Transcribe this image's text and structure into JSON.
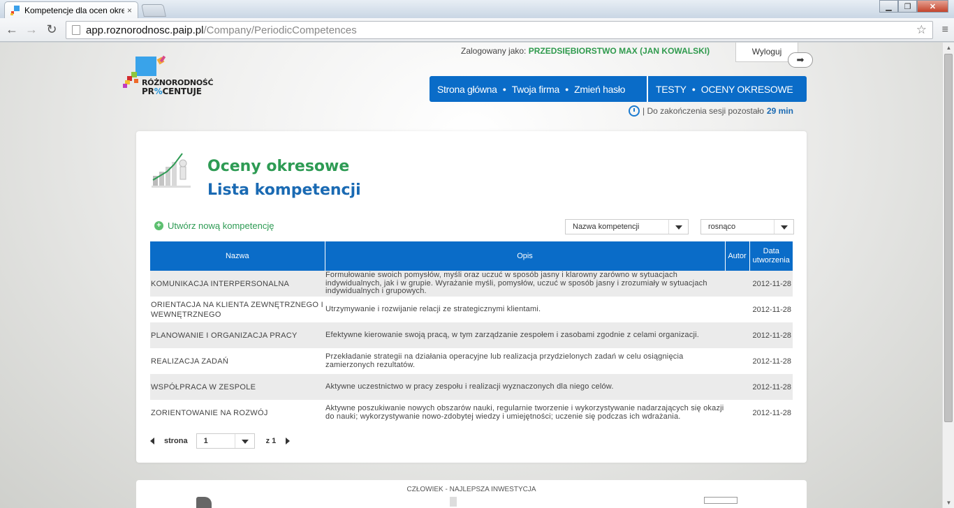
{
  "browser": {
    "tab_title": "Kompetencje dla ocen okresowych",
    "tab_close": "×",
    "url_host": "app.roznorodnosc.paip.pl",
    "url_path": "/Company/PeriodicCompetences",
    "back": "←",
    "forward": "→",
    "reload": "↻",
    "star": "☆",
    "menu": "≡",
    "minimize": "▁",
    "maximize": "❐",
    "close": "✕"
  },
  "header": {
    "logo_line1": "RÓŻNORODNOŚĆ",
    "logo_line2_a": "PR",
    "logo_line2_pct": "%",
    "logo_line2_b": "CENTUJE",
    "login_label": "Zalogowany jako:",
    "login_user": "PRZEDSIĘBIORSTWO MAX (JAN KOWALSKI)",
    "logout_label": "Wyloguj",
    "logout_icon": "➡",
    "nav_group1": [
      "Strona główna",
      "Twoja firma",
      "Zmień hasło"
    ],
    "nav_group2": [
      "TESTY",
      "OCENY OKRESOWE"
    ],
    "nav_dot": "●",
    "session_text": "| Do zakończenia sesji pozostało",
    "session_minutes": "29 min"
  },
  "main": {
    "heading": "Oceny okresowe",
    "subheading": "Lista kompetencji",
    "create_label": "Utwórz nową kompetencję",
    "create_icon": "+",
    "sort_field": "Nazwa kompetencji",
    "sort_order": "rosnąco",
    "columns": [
      "Nazwa",
      "Opis",
      "Autor",
      "Data utworzenia"
    ],
    "rows": [
      {
        "name": "KOMUNIKACJA INTERPERSONALNA",
        "desc": "Formułowanie swoich pomysłów, myśli oraz uczuć w sposób jasny i klarowny zarówno w sytuacjach indywidualnych, jak i w grupie. Wyrażanie myśli, pomysłów, uczuć w sposób jasny i zrozumiały w sytuacjach indywidualnych i grupowych.",
        "author": "",
        "date": "2012-11-28"
      },
      {
        "name": "ORIENTACJA NA KLIENTA ZEWNĘTRZNEGO I WEWNĘTRZNEGO",
        "desc": "Utrzymywanie i rozwijanie relacji ze strategicznymi klientami.",
        "author": "",
        "date": "2012-11-28"
      },
      {
        "name": "PLANOWANIE I ORGANIZACJA PRACY",
        "desc": "Efektywne kierowanie swoją pracą, w tym zarządzanie zespołem i zasobami zgodnie z celami organizacji.",
        "author": "",
        "date": "2012-11-28"
      },
      {
        "name": "REALIZACJA ZADAŃ",
        "desc": "Przekładanie strategii na działania operacyjne lub realizacja przydzielonych zadań w celu osiągnięcia zamierzonych rezultatów.",
        "author": "",
        "date": "2012-11-28"
      },
      {
        "name": "WSPÓŁPRACA W ZESPOLE",
        "desc": "Aktywne uczestnictwo w pracy zespołu i realizacji wyznaczonych dla niego celów.",
        "author": "",
        "date": "2012-11-28"
      },
      {
        "name": "ZORIENTOWANIE NA ROZWÓJ",
        "desc": "Aktywne poszukiwanie nowych obszarów nauki, regularnie tworzenie i wykorzystywanie nadarzających się okazji do nauki; wykorzystywanie nowo-zdobytej wiedzy i umiejętności; uczenie się podczas ich wdrażania.",
        "author": "",
        "date": "2012-11-28"
      }
    ],
    "pager": {
      "label": "strona",
      "page": "1",
      "of": "z 1"
    }
  },
  "footer": {
    "title": "CZŁOWIEK - NAJLEPSZA INWESTYCJA"
  },
  "scrollbar": {
    "up": "▲",
    "down": "▼"
  }
}
